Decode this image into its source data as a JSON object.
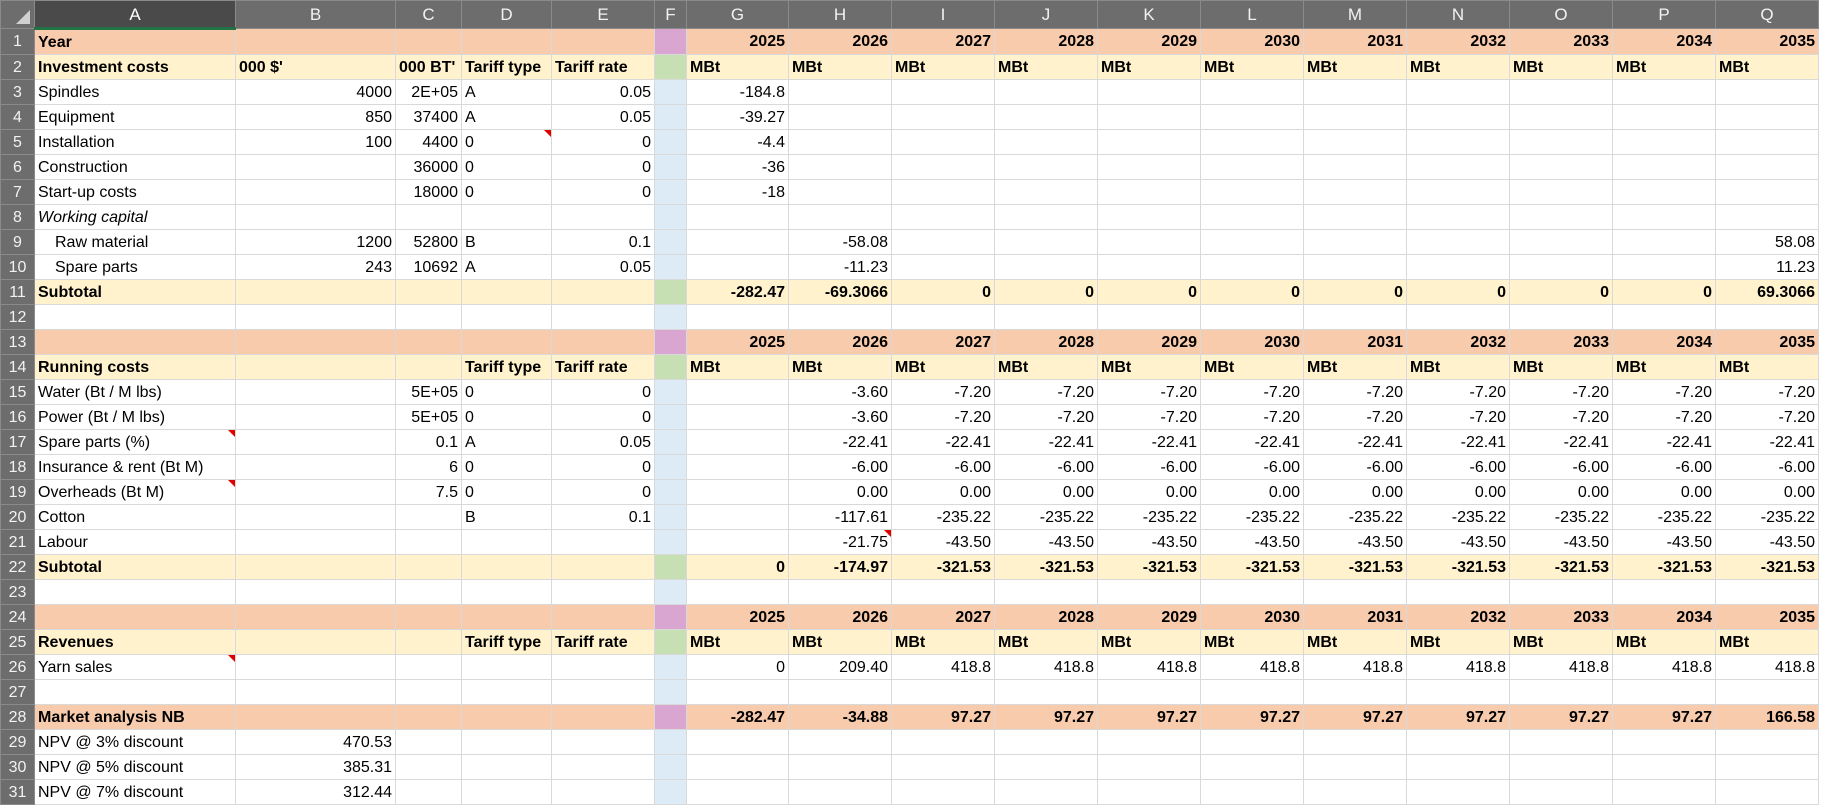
{
  "columns": [
    "A",
    "B",
    "C",
    "D",
    "E",
    "F",
    "G",
    "H",
    "I",
    "J",
    "K",
    "L",
    "M",
    "N",
    "O",
    "P",
    "Q"
  ],
  "rows": [
    {
      "n": "1",
      "style": "orange",
      "cells": {
        "A": "Year",
        "G": "2025",
        "H": "2026",
        "I": "2027",
        "J": "2028",
        "K": "2029",
        "L": "2030",
        "M": "2031",
        "N": "2032",
        "O": "2033",
        "P": "2034",
        "Q": "2035"
      }
    },
    {
      "n": "2",
      "style": "cream",
      "cells": {
        "A": "Investment costs",
        "B": "000 $'",
        "C": "000 BT'",
        "D": "Tariff type",
        "E": "Tariff rate",
        "G": "MBt",
        "H": "MBt",
        "I": "MBt",
        "J": "MBt",
        "K": "MBt",
        "L": "MBt",
        "M": "MBt",
        "N": "MBt",
        "O": "MBt",
        "P": "MBt",
        "Q": "MBt"
      }
    },
    {
      "n": "3",
      "style": "",
      "cells": {
        "A": "Spindles",
        "B": "4000",
        "C": "2E+05",
        "D": "A",
        "E": "0.05",
        "G": "-184.8"
      }
    },
    {
      "n": "4",
      "style": "",
      "cells": {
        "A": "Equipment",
        "B": "850",
        "C": "37400",
        "D": "A",
        "E": "0.05",
        "G": "-39.27"
      }
    },
    {
      "n": "5",
      "style": "",
      "cells": {
        "A": "Installation",
        "B": "100",
        "C": "4400",
        "D": "0",
        "E": "0",
        "G": "-4.4"
      }
    },
    {
      "n": "6",
      "style": "",
      "cells": {
        "A": "Construction",
        "C": "36000",
        "D": "0",
        "E": "0",
        "G": "-36"
      }
    },
    {
      "n": "7",
      "style": "",
      "cells": {
        "A": "Start-up costs",
        "C": "18000",
        "D": "0",
        "E": "0",
        "G": "-18"
      }
    },
    {
      "n": "8",
      "style": "",
      "cells": {
        "A": "Working capital"
      }
    },
    {
      "n": "9",
      "style": "",
      "cells": {
        "A": "Raw material",
        "B": "1200",
        "C": "52800",
        "D": "B",
        "E": "0.1",
        "H": "-58.08",
        "Q": "58.08"
      }
    },
    {
      "n": "10",
      "style": "",
      "cells": {
        "A": "Spare parts",
        "B": "243",
        "C": "10692",
        "D": "A",
        "E": "0.05",
        "H": "-11.23",
        "Q": "11.23"
      }
    },
    {
      "n": "11",
      "style": "cream",
      "cells": {
        "A": "Subtotal",
        "G": "-282.47",
        "H": "-69.3066",
        "I": "0",
        "J": "0",
        "K": "0",
        "L": "0",
        "M": "0",
        "N": "0",
        "O": "0",
        "P": "0",
        "Q": "69.3066"
      }
    },
    {
      "n": "12",
      "style": "",
      "cells": {}
    },
    {
      "n": "13",
      "style": "orange",
      "cells": {
        "G": "2025",
        "H": "2026",
        "I": "2027",
        "J": "2028",
        "K": "2029",
        "L": "2030",
        "M": "2031",
        "N": "2032",
        "O": "2033",
        "P": "2034",
        "Q": "2035"
      }
    },
    {
      "n": "14",
      "style": "cream",
      "cells": {
        "A": "Running costs",
        "D": "Tariff type",
        "E": "Tariff rate",
        "G": "MBt",
        "H": "MBt",
        "I": "MBt",
        "J": "MBt",
        "K": "MBt",
        "L": "MBt",
        "M": "MBt",
        "N": "MBt",
        "O": "MBt",
        "P": "MBt",
        "Q": "MBt"
      }
    },
    {
      "n": "15",
      "style": "",
      "cells": {
        "A": "Water (Bt / M lbs)",
        "C": "5E+05",
        "D": "0",
        "E": "0",
        "H": "-3.60",
        "I": "-7.20",
        "J": "-7.20",
        "K": "-7.20",
        "L": "-7.20",
        "M": "-7.20",
        "N": "-7.20",
        "O": "-7.20",
        "P": "-7.20",
        "Q": "-7.20"
      }
    },
    {
      "n": "16",
      "style": "",
      "cells": {
        "A": "Power (Bt / M lbs)",
        "C": "5E+05",
        "D": "0",
        "E": "0",
        "H": "-3.60",
        "I": "-7.20",
        "J": "-7.20",
        "K": "-7.20",
        "L": "-7.20",
        "M": "-7.20",
        "N": "-7.20",
        "O": "-7.20",
        "P": "-7.20",
        "Q": "-7.20"
      }
    },
    {
      "n": "17",
      "style": "",
      "cells": {
        "A": "Spare parts (%)",
        "C": "0.1",
        "D": "A",
        "E": "0.05",
        "H": "-22.41",
        "I": "-22.41",
        "J": "-22.41",
        "K": "-22.41",
        "L": "-22.41",
        "M": "-22.41",
        "N": "-22.41",
        "O": "-22.41",
        "P": "-22.41",
        "Q": "-22.41"
      }
    },
    {
      "n": "18",
      "style": "",
      "cells": {
        "A": "Insurance & rent (Bt M)",
        "C": "6",
        "D": "0",
        "E": "0",
        "H": "-6.00",
        "I": "-6.00",
        "J": "-6.00",
        "K": "-6.00",
        "L": "-6.00",
        "M": "-6.00",
        "N": "-6.00",
        "O": "-6.00",
        "P": "-6.00",
        "Q": "-6.00"
      }
    },
    {
      "n": "19",
      "style": "",
      "cells": {
        "A": "Overheads (Bt M)",
        "C": "7.5",
        "D": "0",
        "E": "0",
        "H": "0.00",
        "I": "0.00",
        "J": "0.00",
        "K": "0.00",
        "L": "0.00",
        "M": "0.00",
        "N": "0.00",
        "O": "0.00",
        "P": "0.00",
        "Q": "0.00"
      }
    },
    {
      "n": "20",
      "style": "",
      "cells": {
        "A": "Cotton",
        "D": "B",
        "E": "0.1",
        "H": "-117.61",
        "I": "-235.22",
        "J": "-235.22",
        "K": "-235.22",
        "L": "-235.22",
        "M": "-235.22",
        "N": "-235.22",
        "O": "-235.22",
        "P": "-235.22",
        "Q": "-235.22"
      }
    },
    {
      "n": "21",
      "style": "",
      "cells": {
        "A": "Labour",
        "H": "-21.75",
        "I": "-43.50",
        "J": "-43.50",
        "K": "-43.50",
        "L": "-43.50",
        "M": "-43.50",
        "N": "-43.50",
        "O": "-43.50",
        "P": "-43.50",
        "Q": "-43.50"
      }
    },
    {
      "n": "22",
      "style": "cream",
      "cells": {
        "A": "Subtotal",
        "G": "0",
        "H": "-174.97",
        "I": "-321.53",
        "J": "-321.53",
        "K": "-321.53",
        "L": "-321.53",
        "M": "-321.53",
        "N": "-321.53",
        "O": "-321.53",
        "P": "-321.53",
        "Q": "-321.53"
      }
    },
    {
      "n": "23",
      "style": "",
      "cells": {}
    },
    {
      "n": "24",
      "style": "orange",
      "cells": {
        "G": "2025",
        "H": "2026",
        "I": "2027",
        "J": "2028",
        "K": "2029",
        "L": "2030",
        "M": "2031",
        "N": "2032",
        "O": "2033",
        "P": "2034",
        "Q": "2035"
      }
    },
    {
      "n": "25",
      "style": "cream",
      "cells": {
        "A": "Revenues",
        "D": "Tariff type",
        "E": "Tariff rate",
        "G": "MBt",
        "H": "MBt",
        "I": "MBt",
        "J": "MBt",
        "K": "MBt",
        "L": "MBt",
        "M": "MBt",
        "N": "MBt",
        "O": "MBt",
        "P": "MBt",
        "Q": "MBt"
      }
    },
    {
      "n": "26",
      "style": "",
      "cells": {
        "A": "Yarn sales",
        "G": "0",
        "H": "209.40",
        "I": "418.8",
        "J": "418.8",
        "K": "418.8",
        "L": "418.8",
        "M": "418.8",
        "N": "418.8",
        "O": "418.8",
        "P": "418.8",
        "Q": "418.8"
      }
    },
    {
      "n": "27",
      "style": "",
      "cells": {}
    },
    {
      "n": "28",
      "style": "orange",
      "cells": {
        "A": "Market analysis NB",
        "G": "-282.47",
        "H": "-34.88",
        "I": "97.27",
        "J": "97.27",
        "K": "97.27",
        "L": "97.27",
        "M": "97.27",
        "N": "97.27",
        "O": "97.27",
        "P": "97.27",
        "Q": "166.58"
      }
    },
    {
      "n": "29",
      "style": "",
      "cells": {
        "A": "NPV @ 3% discount",
        "B": "470.53"
      }
    },
    {
      "n": "30",
      "style": "",
      "cells": {
        "A": "NPV @ 5% discount",
        "B": "385.31"
      }
    },
    {
      "n": "31",
      "style": "",
      "cells": {
        "A": "NPV @ 7% discount",
        "B": "312.44"
      }
    }
  ]
}
